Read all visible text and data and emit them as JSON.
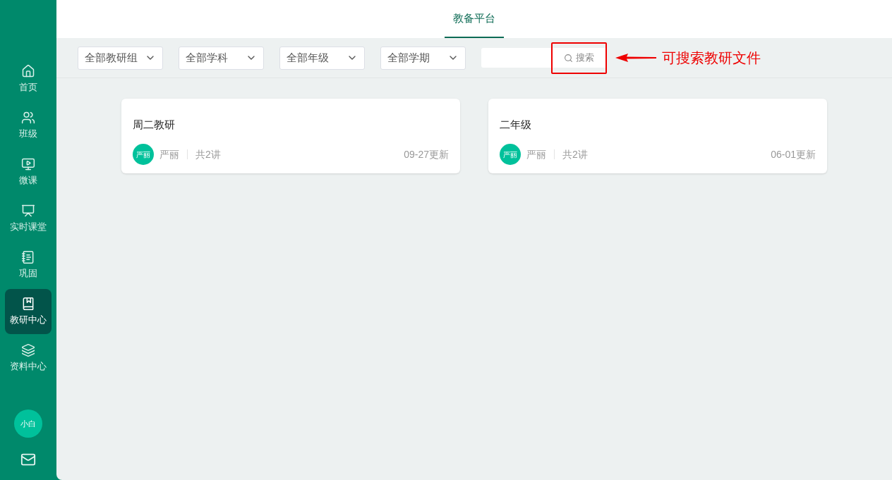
{
  "sidebar": {
    "items": [
      {
        "label": "首页",
        "selected": false
      },
      {
        "label": "班级",
        "selected": false
      },
      {
        "label": "微课",
        "selected": false
      },
      {
        "label": "实时课堂",
        "selected": false
      },
      {
        "label": "巩固",
        "selected": false
      },
      {
        "label": "教研中心",
        "selected": true
      },
      {
        "label": "资料中心",
        "selected": false
      }
    ],
    "user_avatar": "小白"
  },
  "header": {
    "tabs": [
      {
        "label": "教备平台",
        "selected": true
      }
    ]
  },
  "filters": [
    "全部教研组",
    "全部学科",
    "全部年级",
    "全部学期"
  ],
  "search": {
    "button": "搜索"
  },
  "annotation": "可搜索教研文件",
  "cards": [
    {
      "title": "周二教研",
      "avatar": "严丽",
      "author": "严丽",
      "lessons": "共2讲",
      "updated": "09-27更新"
    },
    {
      "title": "二年级",
      "avatar": "严丽",
      "author": "严丽",
      "lessons": "共2讲",
      "updated": "06-01更新"
    }
  ]
}
